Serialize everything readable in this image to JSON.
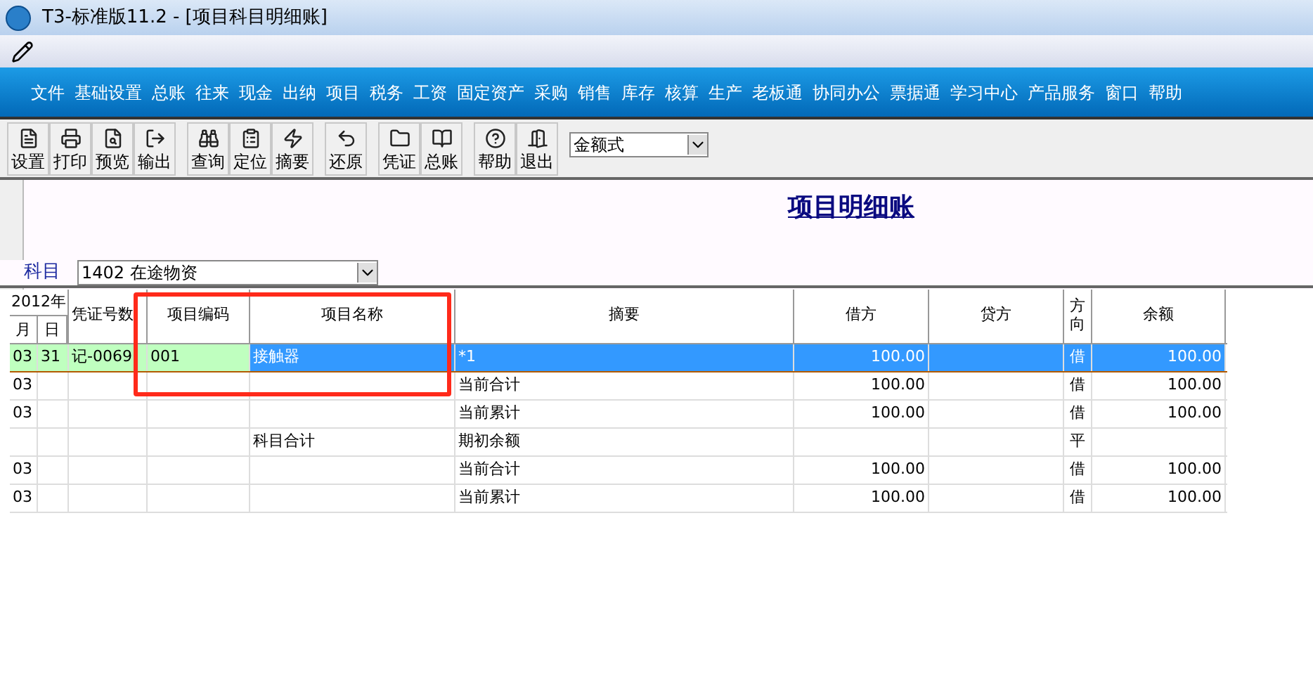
{
  "window": {
    "title": "T3-标准版11.2 - [项目科目明细账]"
  },
  "menu": [
    "文件",
    "基础设置",
    "总账",
    "往来",
    "现金",
    "出纳",
    "项目",
    "税务",
    "工资",
    "固定资产",
    "采购",
    "销售",
    "库存",
    "核算",
    "生产",
    "老板通",
    "协同办公",
    "票据通",
    "学习中心",
    "产品服务",
    "窗口",
    "帮助"
  ],
  "toolbar_groups": [
    [
      "设置",
      "打印",
      "预览",
      "输出"
    ],
    [
      "查询",
      "定位",
      "摘要"
    ],
    [
      "还原"
    ],
    [
      "凭证",
      "总账"
    ],
    [
      "帮助",
      "退出"
    ]
  ],
  "format_select": {
    "value": "金额式"
  },
  "report": {
    "title": "项目明细账",
    "subject_label": "科目",
    "subject_value": "1402 在途物资"
  },
  "table": {
    "column_groups": [
      "2012年"
    ],
    "columns": [
      "月",
      "日",
      "凭证号数",
      "项目编码",
      "项目名称",
      "摘要",
      "借方",
      "贷方",
      "方向",
      "余额"
    ],
    "rows": [
      {
        "selected": true,
        "cells": [
          "03",
          "31",
          "记-0069",
          "001",
          "接触器",
          "*1",
          "100.00",
          "",
          "借",
          "100.00"
        ]
      },
      {
        "selected": false,
        "cells": [
          "03",
          "",
          "",
          "",
          "",
          "当前合计",
          "100.00",
          "",
          "借",
          "100.00"
        ]
      },
      {
        "selected": false,
        "cells": [
          "03",
          "",
          "",
          "",
          "",
          "当前累计",
          "100.00",
          "",
          "借",
          "100.00"
        ]
      },
      {
        "selected": false,
        "cells": [
          "",
          "",
          "",
          "",
          "科目合计",
          "期初余额",
          "",
          "",
          "平",
          ""
        ]
      },
      {
        "selected": false,
        "cells": [
          "03",
          "",
          "",
          "",
          "",
          "当前合计",
          "100.00",
          "",
          "借",
          "100.00"
        ]
      },
      {
        "selected": false,
        "cells": [
          "03",
          "",
          "",
          "",
          "",
          "当前累计",
          "100.00",
          "",
          "借",
          "100.00"
        ]
      }
    ]
  }
}
